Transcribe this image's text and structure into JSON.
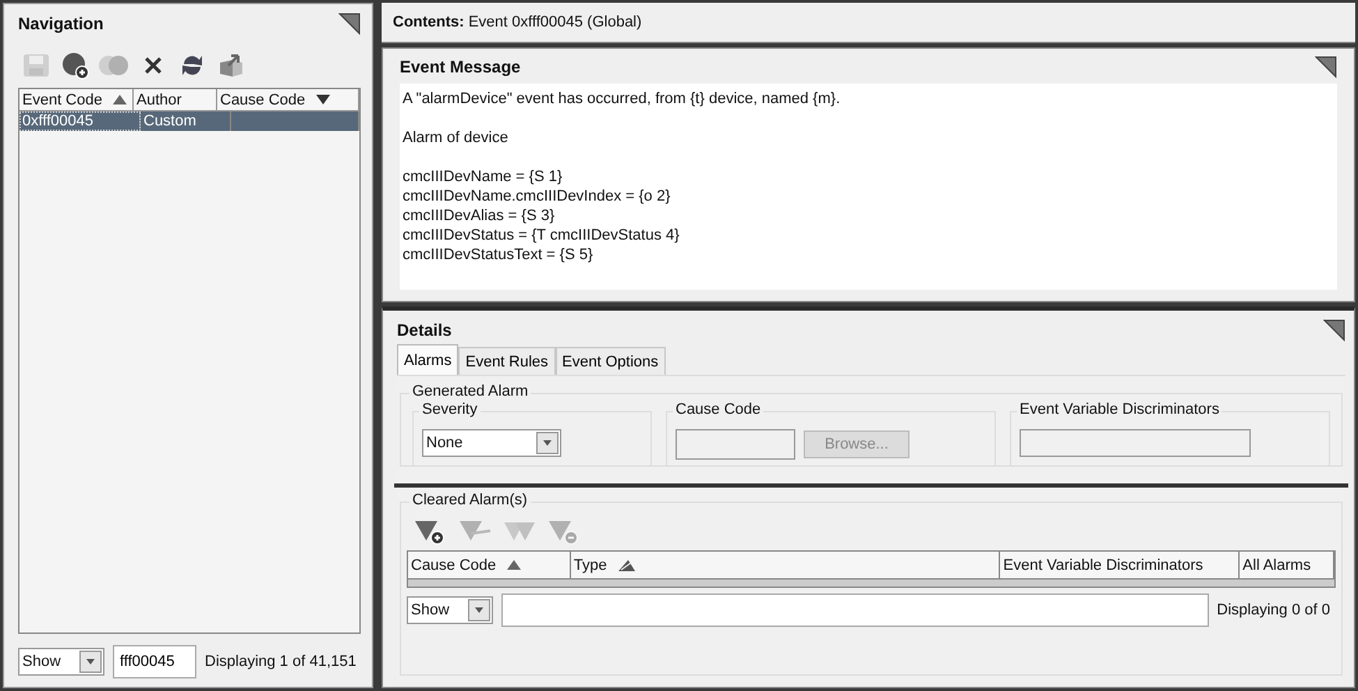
{
  "navigation": {
    "title": "Navigation",
    "toolbar": [
      {
        "kind": "save",
        "disabled": true
      },
      {
        "kind": "add-event",
        "disabled": false
      },
      {
        "kind": "copy-event",
        "disabled": true
      },
      {
        "kind": "delete",
        "disabled": false
      },
      {
        "kind": "refresh",
        "disabled": false
      },
      {
        "kind": "export",
        "disabled": false
      }
    ],
    "table": {
      "columns": [
        {
          "label": "Event Code",
          "sorted": true,
          "descending": false,
          "secondary": false
        },
        {
          "label": "Author",
          "sorted": false
        },
        {
          "label": "Cause Code",
          "sorted": true,
          "descending": true
        }
      ],
      "rows": [
        {
          "cells": [
            "0xfff00045",
            "Custom"
          ],
          "selected": true
        }
      ]
    },
    "filter": {
      "mode": "Show",
      "value": "fff00045",
      "status": "Displaying 1 of 41,151"
    }
  },
  "contents": {
    "label": "Contents:",
    "value": "Event 0xfff00045  (Global)"
  },
  "event_message": {
    "title": "Event Message",
    "paragraphs": [
      [
        "A \"alarmDevice\" event has occurred, from {t} device, named {m}."
      ],
      [
        "Alarm of device"
      ],
      [
        "cmcIIIDevName = {S 1}",
        "cmcIIIDevName.cmcIIIDevIndex = {o 2}",
        "cmcIIIDevAlias = {S 3}",
        "cmcIIIDevStatus = {T cmcIIIDevStatus 4}",
        "cmcIIIDevStatusText = {S 5}"
      ]
    ]
  },
  "details": {
    "title": "Details",
    "tabs": [
      {
        "label": "Alarms",
        "selected": true
      },
      {
        "label": "Event Rules",
        "selected": false
      },
      {
        "label": "Event Options",
        "selected": false
      }
    ],
    "generated_alarm": {
      "title": "Generated Alarm",
      "severity": {
        "label": "Severity",
        "value": "None"
      },
      "cause_code": {
        "label": "Cause Code",
        "browse": "Browse...",
        "disabled": true
      },
      "discriminators": {
        "label": "Event Variable Discriminators"
      }
    },
    "cleared_alarms": {
      "title": "Cleared Alarm(s)",
      "toolbar": [
        {
          "kind": "add",
          "disabled": false
        },
        {
          "kind": "edit",
          "disabled": true
        },
        {
          "kind": "copy",
          "disabled": true
        },
        {
          "kind": "remove",
          "disabled": true
        }
      ],
      "columns": [
        {
          "label": "Cause Code",
          "sorted": true,
          "descending": false,
          "secondary": false
        },
        {
          "label": "Type",
          "sorted": true,
          "descending": false,
          "secondary": true
        },
        {
          "label": "Event Variable Discriminators",
          "sorted": false
        },
        {
          "label": "All Alarms",
          "sorted": false
        }
      ],
      "filter": {
        "mode": "Show",
        "status": "Displaying 0 of 0"
      }
    }
  }
}
